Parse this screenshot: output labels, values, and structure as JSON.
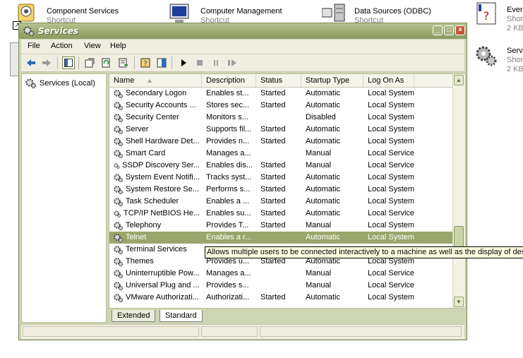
{
  "desktop": {
    "items": [
      {
        "title": "Component Services",
        "sub": "Shortcut"
      },
      {
        "title": "Computer Management",
        "sub": "Shortcut"
      },
      {
        "title": "Data Sources (ODBC)",
        "sub": "Shortcut"
      },
      {
        "title": "Ever",
        "sub": "Shor",
        "size": "2 KB"
      },
      {
        "title": "Serv",
        "sub": "Shor",
        "size": "2 KB"
      }
    ]
  },
  "window": {
    "title": "Services",
    "minimize": "_",
    "maximize": "□",
    "close": "×"
  },
  "menu": [
    "File",
    "Action",
    "View",
    "Help"
  ],
  "toolbar": {
    "icons": [
      "back-arrow-icon",
      "forward-arrow-icon",
      "show-hide-tree-icon",
      "properties-icon",
      "refresh-icon",
      "export-list-icon",
      "help-icon",
      "mmc-view-icon",
      "play-icon",
      "stop-icon",
      "pause-icon",
      "restart-icon"
    ]
  },
  "tree": {
    "root": "Services (Local)"
  },
  "columns": [
    "Name",
    "Description",
    "Status",
    "Startup Type",
    "Log On As"
  ],
  "rows": [
    {
      "name": "Secondary Logon",
      "desc": "Enables st...",
      "status": "Started",
      "startup": "Automatic",
      "logon": "Local System"
    },
    {
      "name": "Security Accounts ...",
      "desc": "Stores sec...",
      "status": "Started",
      "startup": "Automatic",
      "logon": "Local System"
    },
    {
      "name": "Security Center",
      "desc": "Monitors s...",
      "status": "",
      "startup": "Disabled",
      "logon": "Local System"
    },
    {
      "name": "Server",
      "desc": "Supports fil...",
      "status": "Started",
      "startup": "Automatic",
      "logon": "Local System"
    },
    {
      "name": "Shell Hardware Det...",
      "desc": "Provides n...",
      "status": "Started",
      "startup": "Automatic",
      "logon": "Local System"
    },
    {
      "name": "Smart Card",
      "desc": "Manages a...",
      "status": "",
      "startup": "Manual",
      "logon": "Local Service"
    },
    {
      "name": "SSDP Discovery Ser...",
      "desc": "Enables dis...",
      "status": "Started",
      "startup": "Manual",
      "logon": "Local Service"
    },
    {
      "name": "System Event Notifi...",
      "desc": "Tracks syst...",
      "status": "Started",
      "startup": "Automatic",
      "logon": "Local System"
    },
    {
      "name": "System Restore Se...",
      "desc": "Performs s...",
      "status": "Started",
      "startup": "Automatic",
      "logon": "Local System"
    },
    {
      "name": "Task Scheduler",
      "desc": "Enables a ...",
      "status": "Started",
      "startup": "Automatic",
      "logon": "Local System"
    },
    {
      "name": "TCP/IP NetBIOS He...",
      "desc": "Enables su...",
      "status": "Started",
      "startup": "Automatic",
      "logon": "Local Service"
    },
    {
      "name": "Telephony",
      "desc": "Provides T...",
      "status": "Started",
      "startup": "Manual",
      "logon": "Local System"
    },
    {
      "name": "Telnet",
      "desc": "Enables a r...",
      "status": "",
      "startup": "Automatic",
      "logon": "Local System",
      "selected": true
    },
    {
      "name": "Terminal Services",
      "desc": "",
      "status": "",
      "startup": "",
      "logon": ""
    },
    {
      "name": "Themes",
      "desc": "Provides u...",
      "status": "Started",
      "startup": "Automatic",
      "logon": "Local System"
    },
    {
      "name": "Uninterruptible Pow...",
      "desc": "Manages a...",
      "status": "",
      "startup": "Manual",
      "logon": "Local Service"
    },
    {
      "name": "Universal Plug and ...",
      "desc": "Provides s...",
      "status": "",
      "startup": "Manual",
      "logon": "Local Service"
    },
    {
      "name": "VMware Authorizati...",
      "desc": "Authorizati...",
      "status": "Started",
      "startup": "Automatic",
      "logon": "Local System"
    }
  ],
  "tooltip": "Allows multiple users to be connected interactively to a machine as well as the display of desktop",
  "tabs": [
    "Extended",
    "Standard"
  ],
  "active_tab": "Standard",
  "colors": {
    "titlebar": "#99a86c",
    "selection": "#9aa66b"
  }
}
